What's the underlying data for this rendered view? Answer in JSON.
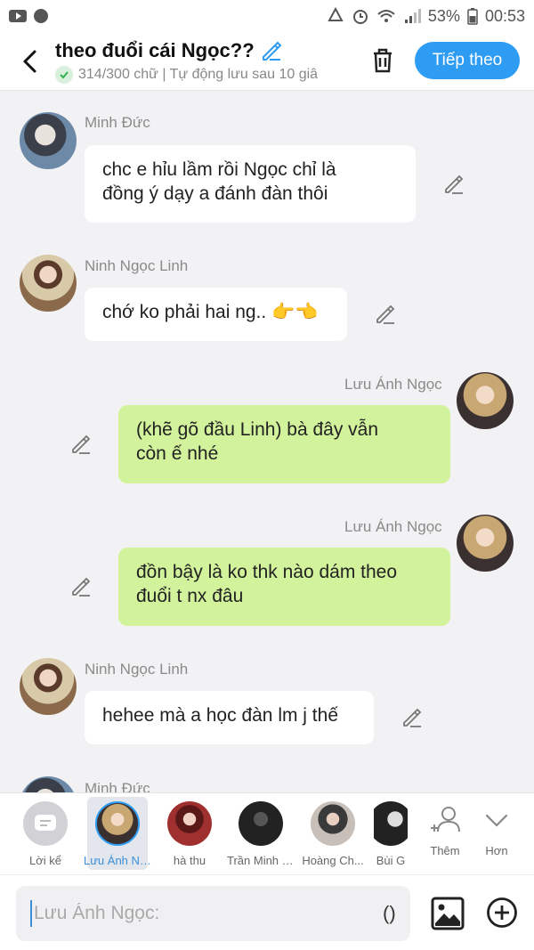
{
  "status_bar": {
    "battery": "53%",
    "time": "00:53"
  },
  "header": {
    "title": "theo đuổi cái Ngọc??",
    "subtitle": "314/300 chữ | Tự động lưu sau 10 giâ",
    "next_label": "Tiếp theo"
  },
  "messages": [
    {
      "sender": "Minh Đức",
      "lines": [
        "chc e hỉu lầm rồi Ngọc chỉ là",
        "đồng ý dạy a đánh đàn thôi"
      ],
      "side": "in"
    },
    {
      "sender": "Ninh Ngọc Linh",
      "lines": [
        "chớ ko phải hai ng.. 👉👈"
      ],
      "side": "in"
    },
    {
      "sender": "Lưu Ánh Ngọc",
      "lines": [
        "(khẽ gõ đầu Linh) bà đây vẫn",
        "còn ế nhé"
      ],
      "side": "out"
    },
    {
      "sender": "Lưu Ánh Ngọc",
      "lines": [
        "đồn bậy là ko thk nào dám theo",
        "đuổi t nx đâu"
      ],
      "side": "out"
    },
    {
      "sender": "Ninh Ngọc Linh",
      "lines": [
        "hehee mà a học đàn lm j thế"
      ],
      "side": "in"
    },
    {
      "sender": "Minh Đức",
      "lines": [],
      "side": "in"
    }
  ],
  "recipients": [
    {
      "label": "Lời kể"
    },
    {
      "label": "Lưu Ánh Ngọc"
    },
    {
      "label": "hà thu"
    },
    {
      "label": "Trần Minh Đức"
    },
    {
      "label": "Hoàng Ch..."
    },
    {
      "label": "Bùi G"
    },
    {
      "label": "Thêm"
    },
    {
      "label": "Hơn"
    }
  ],
  "input": {
    "placeholder": "Lưu Ánh Ngọc:",
    "paren": "()"
  },
  "colors": {
    "accent": "#2e9cf3",
    "out_bubble": "#d2f29c",
    "in_bubble": "#ffffff"
  }
}
